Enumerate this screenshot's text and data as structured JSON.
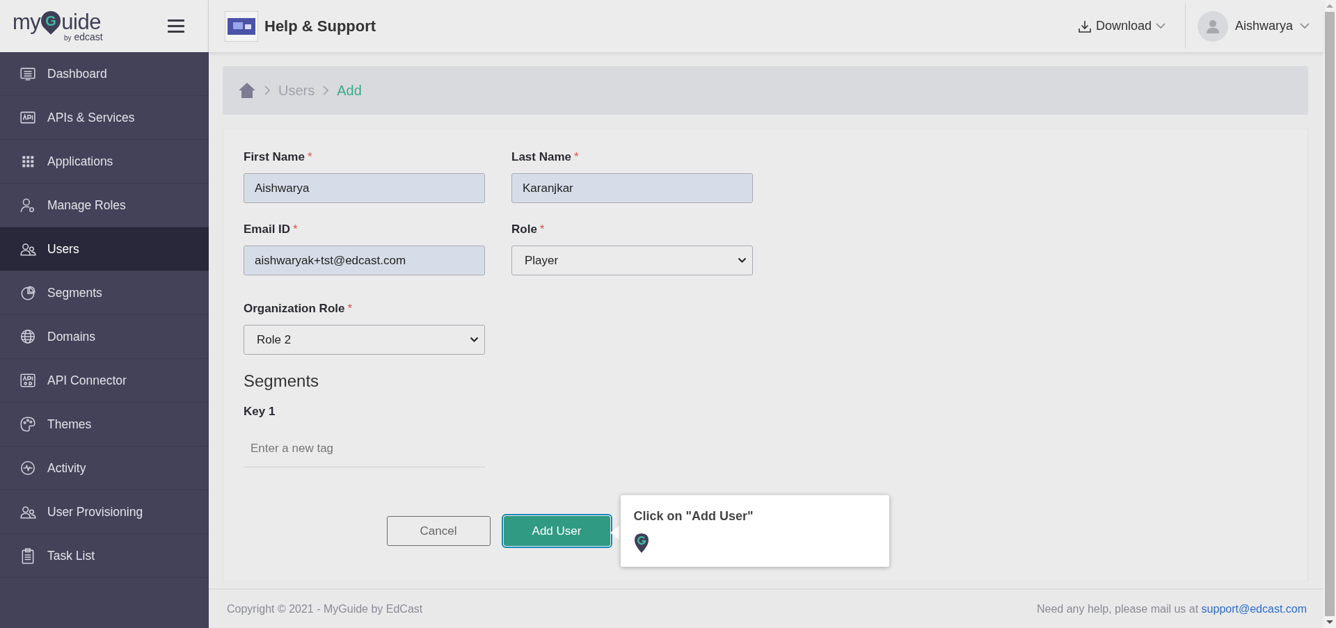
{
  "logo": {
    "name_start": "my",
    "name_letter": "G",
    "name_end": "uide",
    "byline_prefix": "by",
    "byline": "edcast"
  },
  "header": {
    "title": "Help & Support",
    "download": "Download",
    "user": "Aishwarya"
  },
  "sidebar": {
    "items": [
      {
        "label": "Dashboard",
        "selected": false
      },
      {
        "label": "APIs & Services",
        "selected": false
      },
      {
        "label": "Applications",
        "selected": false
      },
      {
        "label": "Manage Roles",
        "selected": false
      },
      {
        "label": "Users",
        "selected": true
      },
      {
        "label": "Segments",
        "selected": false
      },
      {
        "label": "Domains",
        "selected": false
      },
      {
        "label": "API Connector",
        "selected": false
      },
      {
        "label": "Themes",
        "selected": false
      },
      {
        "label": "Activity",
        "selected": false
      },
      {
        "label": "User Provisioning",
        "selected": false
      },
      {
        "label": "Task List",
        "selected": false
      }
    ]
  },
  "breadcrumb": {
    "items": [
      {
        "label": "Users",
        "current": false
      },
      {
        "label": "Add",
        "current": true
      }
    ]
  },
  "form": {
    "fields": [
      {
        "kind": "text",
        "label": "First Name",
        "required_mark": "*",
        "value": "Aishwarya"
      },
      {
        "kind": "text",
        "label": "Last Name",
        "required_mark": "*",
        "value": "Karanjkar"
      },
      {
        "kind": "text",
        "label": "Email ID",
        "required_mark": "*",
        "value": "aishwaryak+tst@edcast.com"
      },
      {
        "kind": "select",
        "label": "Role",
        "required_mark": "*",
        "value": "Player"
      },
      {
        "kind": "select",
        "label": "Organization Role",
        "required_mark": "*",
        "value": "Role 2"
      }
    ]
  },
  "segments": {
    "title": "Segments",
    "keys": [
      {
        "label": "Key 1",
        "placeholder": "Enter a new tag"
      }
    ]
  },
  "buttons": [
    {
      "label": "Cancel",
      "kind": "secondary",
      "highlighted": false
    },
    {
      "label": "Add User",
      "kind": "primary",
      "highlighted": true
    }
  ],
  "tooltip": {
    "text": "Click on \"Add User\""
  },
  "footer": {
    "copyright": "Copyright © 2021 - MyGuide by EdCast",
    "help_text": "Need any help, please mail us at",
    "email": "support@edcast.com"
  }
}
